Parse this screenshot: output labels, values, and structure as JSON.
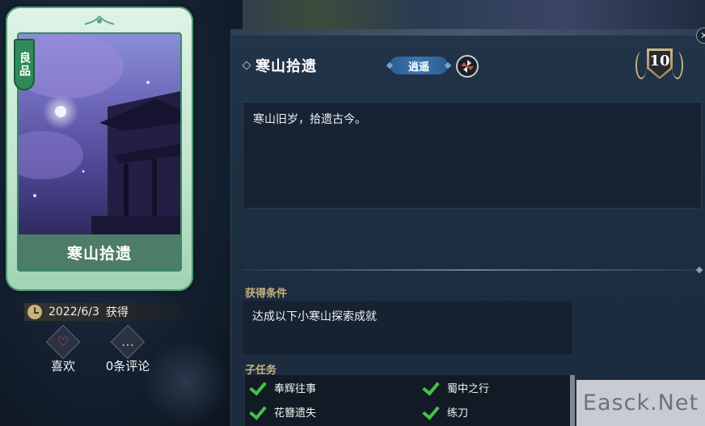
{
  "card": {
    "quality": "良品",
    "name": "寒山拾遗"
  },
  "obtained": {
    "date": "2022/6/3",
    "suffix": "获得"
  },
  "actions": {
    "like_label": "喜欢",
    "comment_label": "0条评论"
  },
  "detail": {
    "title": "寒山拾遗",
    "tag": "逍遥",
    "points": "10",
    "description": "寒山旧岁，拾遗古今。",
    "condition_heading": "获得条件",
    "condition": "达成以下小寒山探索成就",
    "subtasks_heading": "子任务",
    "subtasks": [
      {
        "label": "奉辉往事",
        "done": true
      },
      {
        "label": "蜀中之行",
        "done": true
      },
      {
        "label": "花簪遗失",
        "done": true
      },
      {
        "label": "练刀",
        "done": true
      }
    ]
  },
  "watermark": "Easck.Net",
  "colors": {
    "quality_green": "#2f8a57",
    "accent_gold": "#c9b27d",
    "tag_blue": "#3a78b0",
    "check_green": "#45c24a"
  }
}
